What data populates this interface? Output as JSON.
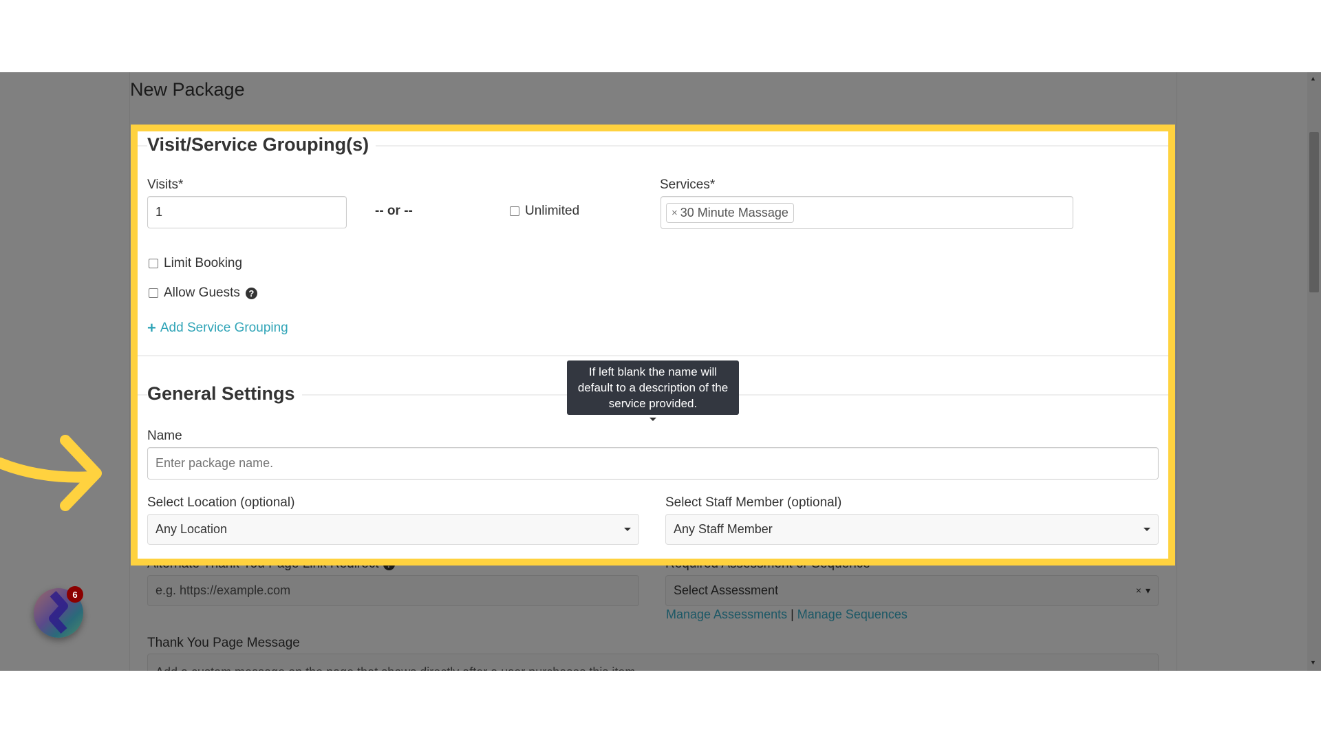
{
  "page": {
    "title": "New Package"
  },
  "service_grouping": {
    "heading": "Visit/Service Grouping(s)",
    "visits_label": "Visits*",
    "visits_value": "1",
    "or_text": "-- or --",
    "unlimited_label": "Unlimited",
    "services_label": "Services*",
    "services_selected": [
      {
        "remove": "×",
        "label": "30 Minute Massage"
      }
    ],
    "limit_booking_label": "Limit Booking",
    "allow_guests_label": "Allow Guests",
    "add_grouping_label": "Add Service Grouping"
  },
  "general_settings": {
    "heading": "General Settings",
    "tooltip": "If left blank the name will default to a description of the service provided.",
    "name_label": "Name",
    "name_placeholder": "Enter package name.",
    "location_label": "Select Location (optional)",
    "location_value": "Any Location",
    "staff_label": "Select Staff Member (optional)",
    "staff_value": "Any Staff Member",
    "redirect_label": "Alternate Thank You Page Link Redirect",
    "redirect_placeholder": "e.g. https://example.com",
    "assessment_label": "Required Assessment or Sequence",
    "assessment_value": "Select Assessment",
    "assessment_clear": "×",
    "manage_assessments": "Manage Assessments",
    "link_separator": "|",
    "manage_sequences": "Manage Sequences",
    "thank_you_label": "Thank You Page Message",
    "thank_you_placeholder": "Add a custom message on the page that shows directly after a user purchases this item."
  },
  "widget": {
    "badge_count": "6"
  },
  "colors": {
    "highlight": "#ffd23f",
    "link": "#2fa4b7",
    "overlay": "#808080",
    "tooltip": "#333740",
    "badge": "#8b0000"
  }
}
